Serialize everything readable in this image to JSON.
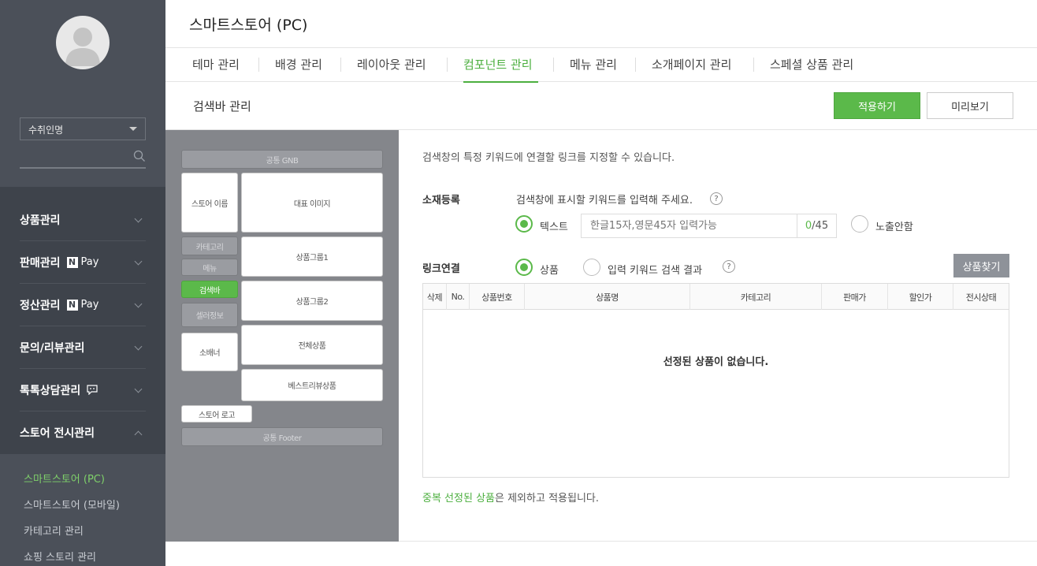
{
  "app": {
    "title": "스마트스토어 (PC)"
  },
  "sidebar": {
    "store_select": "수취인명",
    "search_placeholder": "",
    "menu": [
      {
        "label": "상품관리",
        "badge": "",
        "expanded": false
      },
      {
        "label": "판매관리",
        "badge": "Pay",
        "expanded": false
      },
      {
        "label": "정산관리",
        "badge": "Pay",
        "expanded": false
      },
      {
        "label": "문의/리뷰관리",
        "badge": "",
        "expanded": false
      },
      {
        "label": "톡톡상담관리",
        "badge": "",
        "expanded": false
      },
      {
        "label": "스토어 전시관리",
        "badge": "",
        "expanded": true
      }
    ],
    "npay_mark": "N",
    "submenu": [
      {
        "label": "스마트스토어 (PC)",
        "active": true
      },
      {
        "label": "스마트스토어 (모바일)",
        "active": false
      },
      {
        "label": "카테고리 관리",
        "active": false
      },
      {
        "label": "쇼핑 스토리 관리",
        "active": false
      }
    ]
  },
  "tabs": [
    {
      "label": "테마 관리",
      "active": false
    },
    {
      "label": "배경 관리",
      "active": false
    },
    {
      "label": "레이아웃 관리",
      "active": false
    },
    {
      "label": "컴포넌트 관리",
      "active": true
    },
    {
      "label": "메뉴 관리",
      "active": false
    },
    {
      "label": "소개페이지 관리",
      "active": false
    },
    {
      "label": "스페셜 상품 관리",
      "active": false
    }
  ],
  "section": {
    "title": "검색바 관리",
    "apply_label": "적용하기",
    "preview_label": "미리보기"
  },
  "layout_preview": {
    "gnb": "공통 GNB",
    "store_name": "스토어 이름",
    "main_image": "대표 이미지",
    "category": "카테고리",
    "menu": "메뉴",
    "searchbar": "검색바",
    "seller_info": "셀러정보",
    "small_banner": "소배너",
    "group1": "상품그룹1",
    "group2": "상품그룹2",
    "all_products": "전체상품",
    "best_review": "베스트리뷰상품",
    "store_logo": "스토어 로고",
    "footer": "공통 Footer"
  },
  "content": {
    "description": "검색창의 특정 키워드에 연결할 링크를 지정할 수 있습니다.",
    "material_label": "소재등록",
    "keyword_hint": "검색창에 표시할 키워드를 입력해 주세요.",
    "help_mark": "?",
    "text_option": "텍스트",
    "keyword_placeholder": "한글15자,영문45자 입력가능",
    "count_current": "0",
    "count_max": "/45",
    "hide_option": "노출안함",
    "link_label": "링크연결",
    "product_option": "상품",
    "search_result_option": "입력 키워드 검색 결과",
    "find_button": "상품찾기",
    "table_headers": [
      "삭제",
      "No.",
      "상품번호",
      "상품명",
      "카테고리",
      "판매가",
      "할인가",
      "전시상태"
    ],
    "empty_message": "선정된 상품이 없습니다.",
    "note_highlight": "중복 선정된 상품",
    "note_rest": "은 제외하고 적용됩니다."
  }
}
